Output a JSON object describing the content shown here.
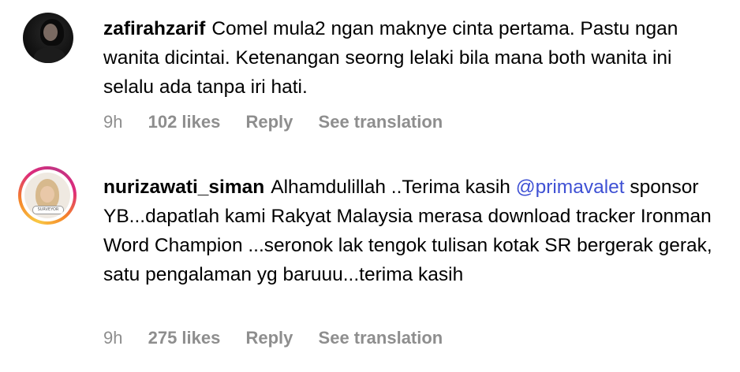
{
  "comments": [
    {
      "username": "zafirahzarif",
      "text": "Comel mula2 ngan maknye cinta pertama. Pastu ngan wanita dicintai. Ketenangan seorng lelaki bila mana both wanita ini selalu ada tanpa iri hati.",
      "time": "9h",
      "likes": "102 likes",
      "reply_label": "Reply",
      "translate_label": "See translation",
      "avatar_icon": "profile-photo-dark"
    },
    {
      "username": "nurizawati_siman",
      "text_before_mention": "Alhamdulillah ..Terima kasih ",
      "mention": "@primavalet",
      "text_after_mention": " sponsor YB...dapatlah kami Rakyat Malaysia merasa download tracker Ironman Word Champion ...seronok lak tengok tulisan kotak SR bergerak gerak, satu pengalaman yg baruuu...terima kasih",
      "time": "9h",
      "likes": "275 likes",
      "reply_label": "Reply",
      "translate_label": "See translation",
      "avatar_icon": "profile-photo-story-ring",
      "avatar_badge_text": "SURVEYOR"
    }
  ],
  "colors": {
    "mention": "#3f51d4",
    "meta_text": "#8e8e8e",
    "story_ring_start": "#f9c843",
    "story_ring_end": "#c13584"
  }
}
